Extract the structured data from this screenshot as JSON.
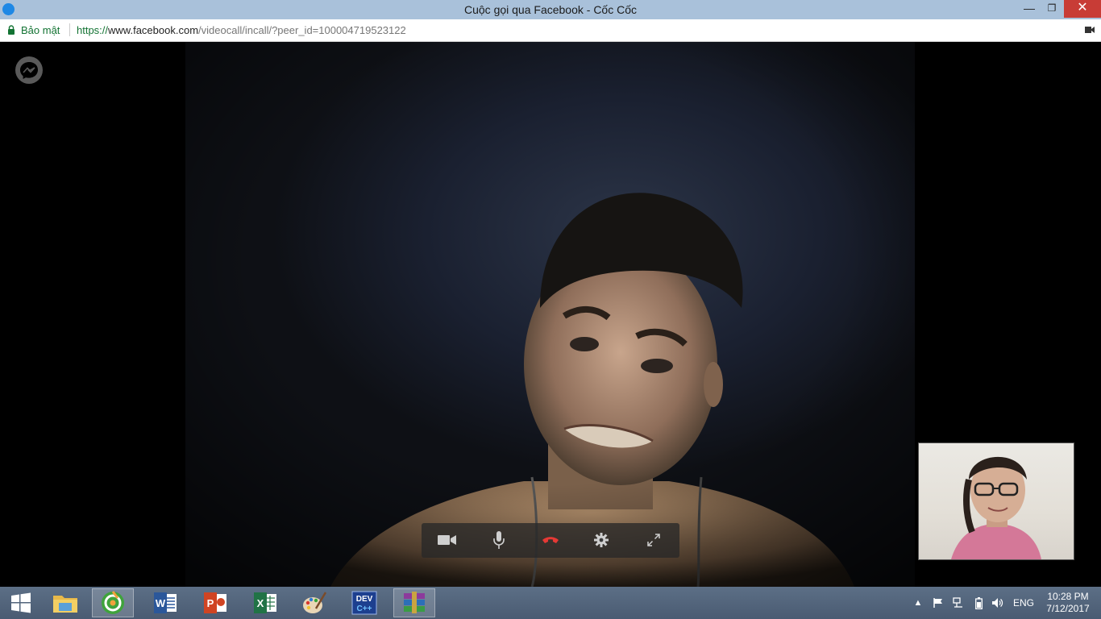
{
  "window": {
    "title": "Cuộc gọi qua Facebook - Cốc Cốc",
    "min_icon": "minimize-icon",
    "max_icon": "restore-icon",
    "close_icon": "close-icon"
  },
  "addressbar": {
    "secure_label": "Bảo mật",
    "url_proto": "https://",
    "url_host": "www.facebook.com",
    "url_path": "/videocall/incall/?peer_id=100004719523122",
    "camera_indicator_icon": "camera-in-use-icon"
  },
  "call": {
    "logo_icon": "messenger-icon",
    "controls": [
      {
        "name": "toggle-camera-button",
        "icon": "video-camera-icon"
      },
      {
        "name": "toggle-mic-button",
        "icon": "microphone-icon"
      },
      {
        "name": "end-call-button",
        "icon": "hang-up-icon"
      },
      {
        "name": "call-settings-button",
        "icon": "gear-icon"
      },
      {
        "name": "fullscreen-button",
        "icon": "expand-icon"
      }
    ]
  },
  "taskbar": {
    "items": [
      {
        "name": "start-button",
        "icon": "windows-logo-icon"
      },
      {
        "name": "taskbar-file-explorer",
        "icon": "folder-icon"
      },
      {
        "name": "taskbar-coccoc",
        "icon": "coccoc-browser-icon"
      },
      {
        "name": "taskbar-word",
        "icon": "word-icon"
      },
      {
        "name": "taskbar-powerpoint",
        "icon": "powerpoint-icon"
      },
      {
        "name": "taskbar-excel",
        "icon": "excel-icon"
      },
      {
        "name": "taskbar-paint",
        "icon": "paint-icon"
      },
      {
        "name": "taskbar-devcpp",
        "icon": "devcpp-icon"
      },
      {
        "name": "taskbar-winrar",
        "icon": "winrar-icon"
      }
    ],
    "tray": {
      "language": "ENG",
      "time": "10:28 PM",
      "date": "7/12/2017"
    }
  },
  "colors": {
    "titlebar": "#a9c1da",
    "secure_green": "#137333",
    "close_red": "#c83c36",
    "hangup_red": "#e53935",
    "taskbar": "#52637a"
  }
}
